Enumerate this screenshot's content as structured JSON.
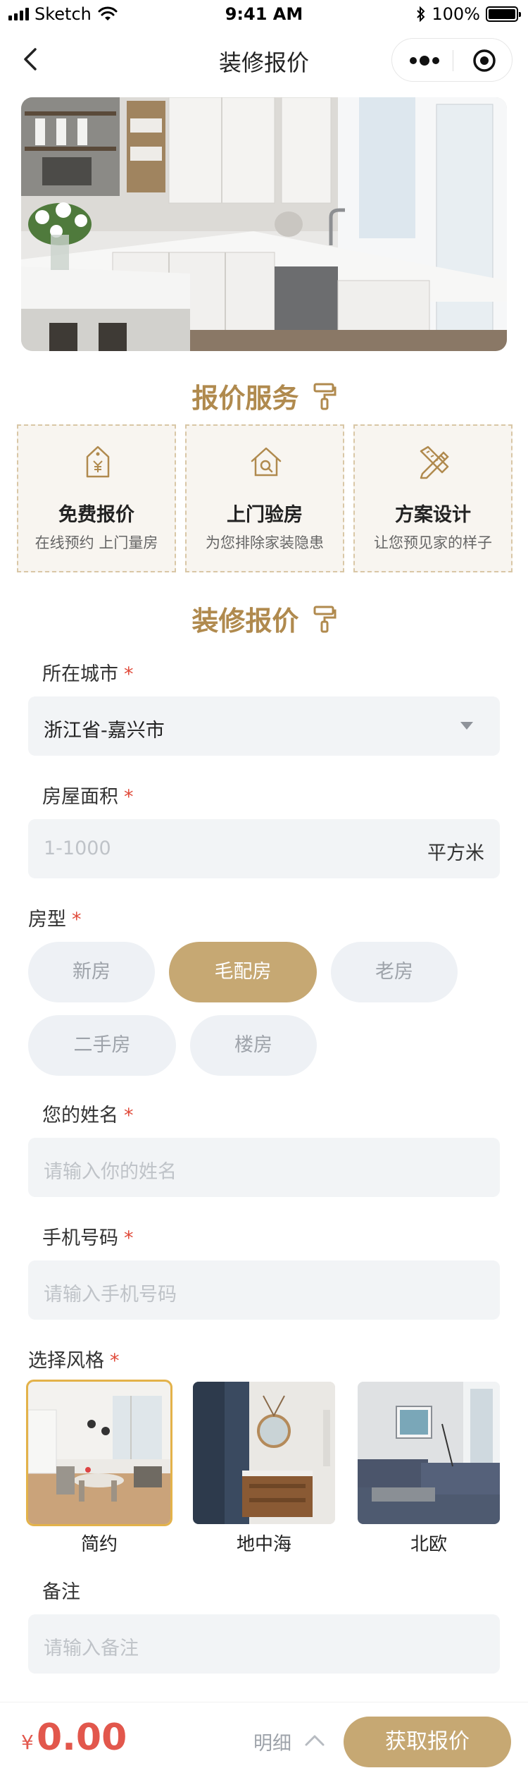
{
  "status_bar": {
    "carrier": "Sketch",
    "time": "9:41 AM",
    "battery": "100%"
  },
  "nav": {
    "title": "装修报价"
  },
  "services_section": {
    "title": "报价服务",
    "items": [
      {
        "name": "免费报价",
        "desc": "在线预约 上门量房",
        "icon": "price-tag-icon"
      },
      {
        "name": "上门验房",
        "desc": "为您排除家装隐患",
        "icon": "house-search-icon"
      },
      {
        "name": "方案设计",
        "desc": "让您预见家的样子",
        "icon": "pencil-ruler-icon"
      }
    ]
  },
  "quote_section": {
    "title": "装修报价"
  },
  "form": {
    "city": {
      "label": "所在城市",
      "required": "*",
      "value": "浙江省-嘉兴市"
    },
    "area": {
      "label": "房屋面积",
      "required": "*",
      "placeholder": "1-1000",
      "unit": "平方米"
    },
    "house_type": {
      "label": "房型",
      "required": "*",
      "options": [
        "新房",
        "毛配房",
        "老房",
        "二手房",
        "楼房"
      ],
      "selected": "毛配房"
    },
    "name": {
      "label": "您的姓名",
      "required": "*",
      "placeholder": "请输入你的姓名"
    },
    "phone": {
      "label": "手机号码",
      "required": "*",
      "placeholder": "请输入手机号码"
    },
    "style": {
      "label": "选择风格",
      "required": "*",
      "options": [
        "简约",
        "地中海",
        "北欧"
      ],
      "selected": "简约"
    },
    "remark": {
      "label": "备注",
      "placeholder": "请输入备注"
    }
  },
  "bottom_bar": {
    "currency": "¥",
    "price": "0.00",
    "detail_label": "明细",
    "submit_label": "获取报价"
  },
  "colors": {
    "accent": "#c6a873",
    "title_gold": "#b08a4e",
    "price_red": "#e2574c",
    "required_red": "#e04a3a",
    "field_bg": "#f2f4f6"
  }
}
